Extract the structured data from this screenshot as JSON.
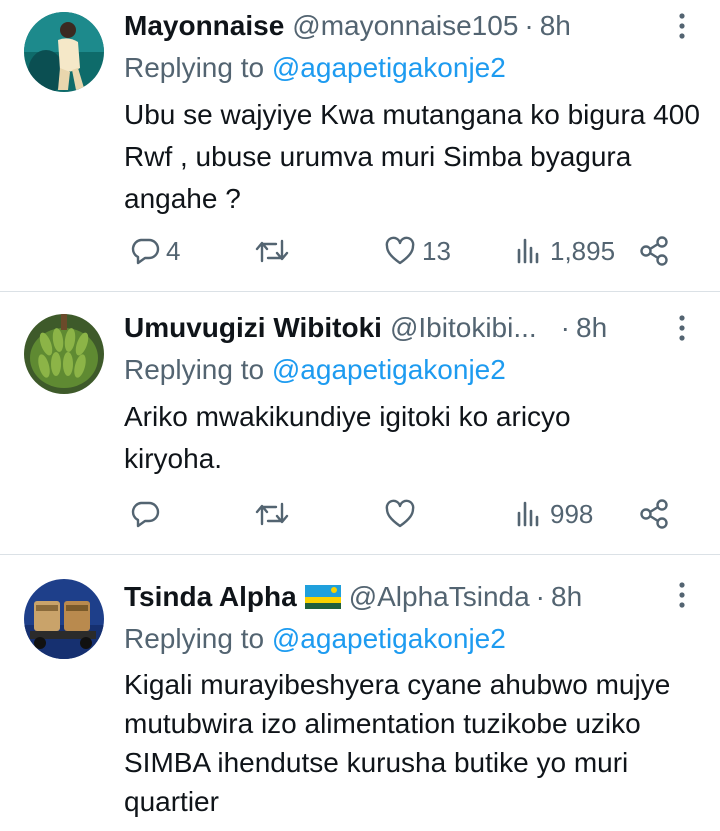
{
  "tweets": [
    {
      "name": "Mayonnaise",
      "handle": "@mayonnaise105",
      "separator": "·",
      "time": "8h",
      "replying_prefix": "Replying to ",
      "replying_to": "@agapetigakonje2",
      "text": "Ubu se wajyiye Kwa mutangana ko bigura 400 Rwf , ubuse urumva muri Simba byagura angahe ?",
      "replies": "4",
      "retweets": "",
      "likes": "13",
      "views": "1,895"
    },
    {
      "name": "Umuvugizi Wibitoki",
      "handle": "@Ibitokibi...",
      "separator": "·",
      "time": "8h",
      "replying_prefix": "Replying to ",
      "replying_to": "@agapetigakonje2",
      "text": "Ariko mwakikundiye igitoki ko aricyo kiryoha.",
      "replies": "",
      "retweets": "",
      "likes": "",
      "views": "998"
    },
    {
      "name": "Tsinda Alpha",
      "handle": "@AlphaTsinda",
      "separator": "·",
      "time": "8h",
      "flag": "rwanda-flag",
      "replying_prefix": "Replying to ",
      "replying_to": "@agapetigakonje2",
      "text": "Kigali murayibeshyera cyane ahubwo mujye mutubwira izo alimentation tuzikobe uziko SIMBA ihendutse kurusha butike yo muri quartier"
    }
  ],
  "colors": {
    "text": "#0f1419",
    "secondary": "#536471",
    "link": "#1d9bf0",
    "divider": "#dbe1e6"
  },
  "icons": [
    "reply-icon",
    "retweet-icon",
    "like-icon",
    "views-icon",
    "share-icon",
    "more-icon"
  ]
}
